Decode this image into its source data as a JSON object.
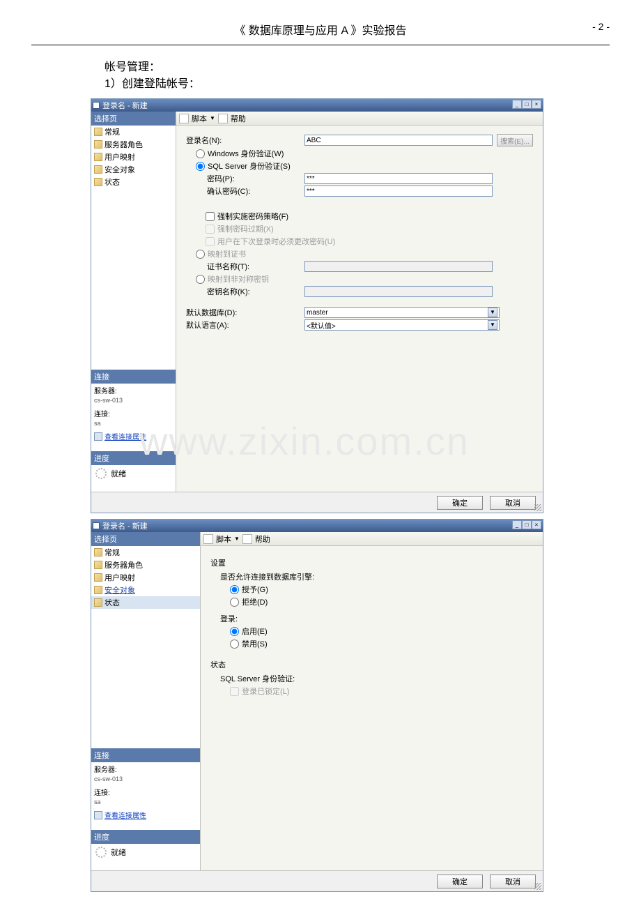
{
  "page": {
    "header_title": "《 数据库原理与应用 A 》实验报告",
    "page_number": "- 2 -",
    "intro_line1": "帐号管理：",
    "intro_line2": "1）创建登陆帐号："
  },
  "watermark": "www.zixin.com.cn",
  "dialog1": {
    "title": "登录名 - 新建",
    "sidebar_head": "选择页",
    "sidebar_items": [
      "常规",
      "服务器角色",
      "用户映射",
      "安全对象",
      "状态"
    ],
    "conn_head": "连接",
    "server_label": "服务器:",
    "server_value": "cs-sw-013",
    "conn_label": "连接:",
    "conn_value": "sa",
    "view_link": "查看连接属性",
    "progress_head": "进度",
    "progress_status": "就绪",
    "toolbar_script": "脚本",
    "toolbar_help": "帮助",
    "login_name_label": "登录名(N):",
    "login_name_value": "ABC",
    "search_btn": "搜索(E)...",
    "win_auth": "Windows 身份验证(W)",
    "sql_auth": "SQL Server 身份验证(S)",
    "pwd_label": "密码(P):",
    "pwd_value": "***",
    "pwd_confirm_label": "确认密码(C):",
    "pwd_confirm_value": "***",
    "enforce_policy": "强制实施密码策略(F)",
    "enforce_expire": "强制密码过期(X)",
    "must_change": "用户在下次登录时必须更改密码(U)",
    "map_cert": "映射到证书",
    "cert_name_label": "证书名称(T):",
    "map_key": "映射到非对称密钥",
    "key_name_label": "密钥名称(K):",
    "default_db_label": "默认数据库(D):",
    "default_db_value": "master",
    "default_lang_label": "默认语言(A):",
    "default_lang_value": "<默认值>",
    "ok_btn": "确定",
    "cancel_btn": "取消"
  },
  "dialog2": {
    "title": "登录名 - 新建",
    "settings_head": "设置",
    "allow_conn_label": "是否允许连接到数据库引擎:",
    "grant": "授予(G)",
    "deny": "拒绝(D)",
    "login_head": "登录:",
    "enable": "启用(E)",
    "disable": "禁用(S)",
    "status_head": "状态",
    "sql_auth_label": "SQL Server 身份验证:",
    "login_locked": "登录已锁定(L)"
  }
}
